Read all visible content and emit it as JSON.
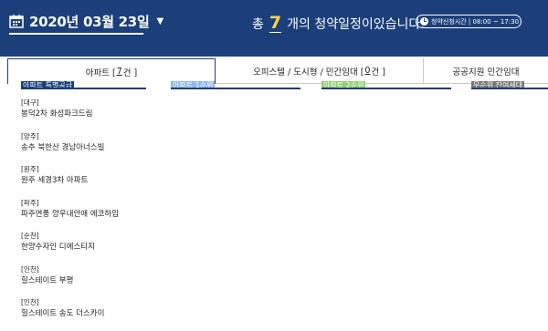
{
  "header": {
    "date": "2020년 03월 23일",
    "summary_prefix": "총",
    "count": "7",
    "summary_suffix": "개의 청약일정이있습니다.",
    "time_label": "청약신청시간 | 08:00 ~ 17:30"
  },
  "tabs": [
    {
      "label": "아파트 [",
      "count": "7",
      "suffix": "건 ]"
    },
    {
      "label": "오피스텔 / 도시형 / 민간임대 [",
      "count": "0",
      "suffix": "건 ]"
    },
    {
      "label": "공공지원 민간임대",
      "count": "",
      "suffix": ""
    }
  ],
  "categories": [
    "아파트 특별공급",
    "아파트 1순위",
    "아파트 2순위",
    "무순위 잔여세대"
  ],
  "listings": [
    {
      "region": "[대구]",
      "name": "봉덕2차 화성파크드림"
    },
    {
      "region": "[양주]",
      "name": "송추 북한산 경남아너스빌"
    },
    {
      "region": "[원주]",
      "name": "원주 세경3차 아파트"
    },
    {
      "region": "[파주]",
      "name": "파주연풍 양우내안애 에코하임"
    },
    {
      "region": "[순천]",
      "name": "한양수자인 디에스티지"
    },
    {
      "region": "[인천]",
      "name": "힐스테이트 부평"
    },
    {
      "region": "[인천]",
      "name": "힐스테이트 송도 더스카이"
    }
  ],
  "colors": {
    "header_bg": "#1b3f7a",
    "count_accent": "#ffd34d"
  }
}
